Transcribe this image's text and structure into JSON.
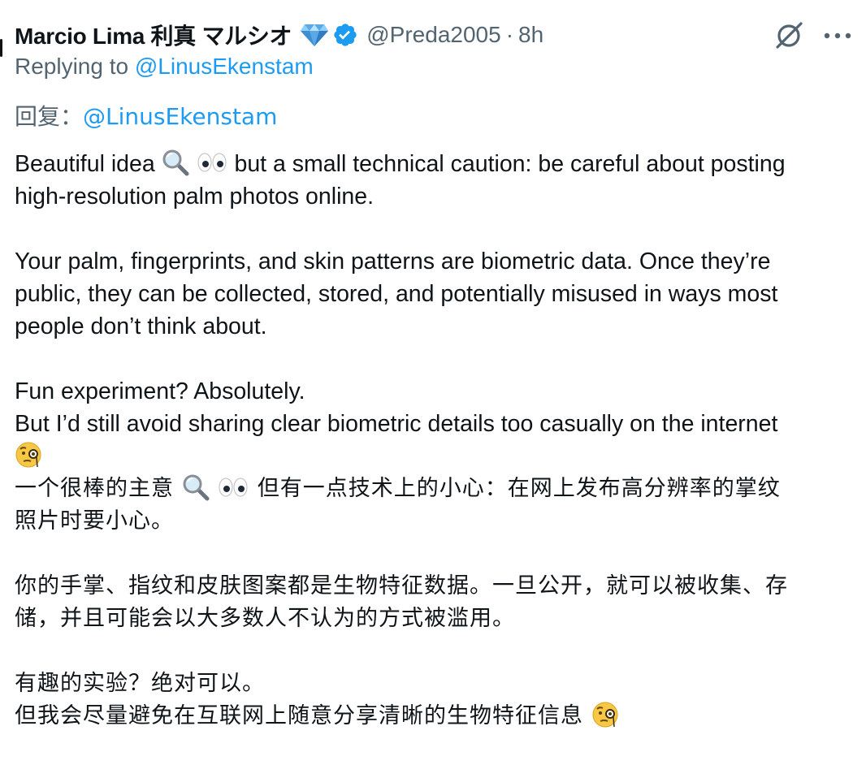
{
  "post": {
    "display_name": "Marcio Lima 利真 マルシオ",
    "handle": "@Preda2005",
    "dot": "·",
    "time": "8h",
    "replying_prefix": "Replying to ",
    "replying_handle": "@LinusEkenstam",
    "cn_reply_prefix": "回复：",
    "cn_reply_handle": "@LinusEkenstam"
  },
  "icons": {
    "badge": "gem-icon",
    "verified": "verified-badge-icon",
    "grok": "grok-icon",
    "more": "more-options-icon",
    "search_emoji": "magnifying-glass-icon",
    "eyes_emoji": "eyes-icon",
    "monocle_emoji": "face-with-monocle-icon"
  },
  "colors": {
    "text": "#0f1419",
    "secondary": "#536471",
    "link": "#1d9bf0",
    "verified": "#1d9bf0",
    "gem": "#5aa9e6"
  },
  "body": {
    "en_1a": "Beautiful idea",
    "en_1b": "but a small technical caution: be careful about posting",
    "en_2": "high-resolution palm photos online.",
    "en_3": "Your palm, fingerprints, and skin patterns are biometric data. Once they’re",
    "en_4": "public, they can be collected, stored, and potentially misused in ways most",
    "en_5": "people don’t think about.",
    "en_6": "Fun experiment? Absolutely.",
    "en_7": "But I’d still avoid sharing clear biometric details too casually on the internet",
    "cn_1a": "一个很棒的主意",
    "cn_1b": "但有一点技术上的小心：在网上发布高分辨率的掌纹",
    "cn_2": "照片时要小心。",
    "cn_3": "你的手掌、指纹和皮肤图案都是生物特征数据。一旦公开，就可以被收集、存",
    "cn_4": "储，并且可能会以大多数人不认为的方式被滥用。",
    "cn_5": "有趣的实验？绝对可以。",
    "cn_6": "但我会尽量避免在互联网上随意分享清晰的生物特征信息"
  }
}
